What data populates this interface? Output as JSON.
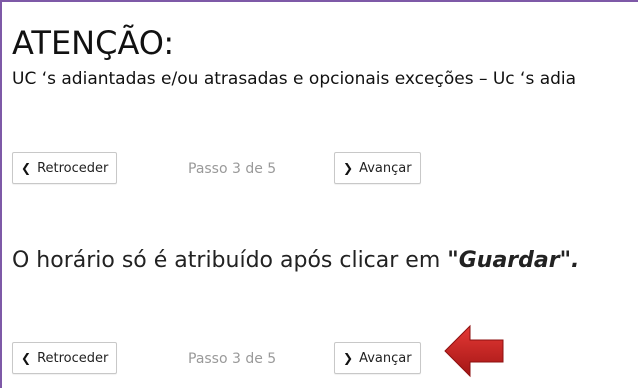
{
  "header": {
    "title": "ATENÇÃO:",
    "subtitle": "UC ‘s adiantadas e/ou atrasadas e opcionais exceções – Uc ‘s adia"
  },
  "navigation_top": {
    "back_label": "Retroceder",
    "step_text": "Passo 3 de 5",
    "next_label": "Avançar"
  },
  "notice": {
    "text_before": "O horário só é atribuído após clicar em ",
    "emphasis": "\"Guardar\"."
  },
  "navigation_bottom": {
    "back_label": "Retroceder",
    "step_text": "Passo 3 de 5",
    "next_label": "Avançar"
  },
  "icons": {
    "back": "chevron-left-icon",
    "next": "chevron-right-icon",
    "pointer": "red-arrow-icon"
  },
  "colors": {
    "frame_border": "#7e59a7",
    "arrow": "#c62828"
  }
}
